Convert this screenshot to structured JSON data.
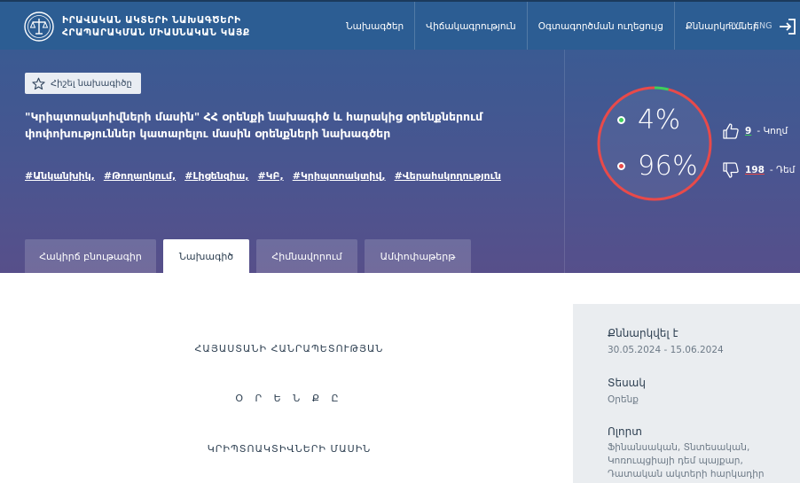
{
  "header": {
    "logo_line1": "ԻՐԱՎԱԿԱՆ ԱԿՏԵՐԻ ՆԱԽԱԳԾԵՐԻ",
    "logo_line2": "ՀՐԱՊԱՐԱԿՄԱՆ ՄԻԱՍՆԱԿԱՆ ԿԱՅՔ",
    "nav": [
      "Նախագծեր",
      "Վիճակագրություն",
      "Օգտագործման ուղեցույց",
      "Քննարկումներ"
    ],
    "lang_ru": "РУС",
    "lang_en": "ENG"
  },
  "hero": {
    "favorite_label": "Հիշել նախագիծը",
    "title": "\"Կրիպտոակտիվների մասին\" ՀՀ օրենքի նախագիծ և հարակից օրենքներում փոփոխություններ կատարելու մասին օրենքների նախագծեր",
    "tags": [
      "#Անկանխիկ,",
      "#Թողարկում,",
      "#Լիցենզիա,",
      "#ԿԲ,",
      "#Կրիպտոակտիվ,",
      "#Վերահսկողություն"
    ],
    "tabs": [
      "Հակիրճ բնութագիր",
      "Նախագիծ",
      "Հիմնավորում",
      "Ամփոփաթերթ"
    ],
    "active_tab": 1
  },
  "votes": {
    "for_percent": 4,
    "against_percent": 96,
    "for_display": "4%",
    "against_display": "96%",
    "for_count": "9",
    "for_label": "- Կողմ",
    "against_count": "198",
    "against_label": "- Դեմ",
    "colors": {
      "for": "#3ecf5b",
      "against": "#e84a4a"
    }
  },
  "document": {
    "line1": "ՀԱՅԱՍՏԱՆԻ ՀԱՆՐԱՊԵՏՈՒԹՅԱՆ",
    "line2": "Օ Ր Ե Ն Ք Ը",
    "line3": "ԿՐԻՊՏՈԱԿՏԻՎՆԵՐԻ ՄԱՍԻՆ"
  },
  "sidebar": {
    "discussed_label": "Քննարկվել է",
    "discussed_value": "30.05.2024 - 15.06.2024",
    "type_label": "Տեսակ",
    "type_value": "Օրենք",
    "area_label": "Ոլորտ",
    "area_value": "Ֆինանսական, Տնտեսական, Կոռուպցիայի դեմ պայքար, Դատական ակտերի հարկադիր"
  }
}
